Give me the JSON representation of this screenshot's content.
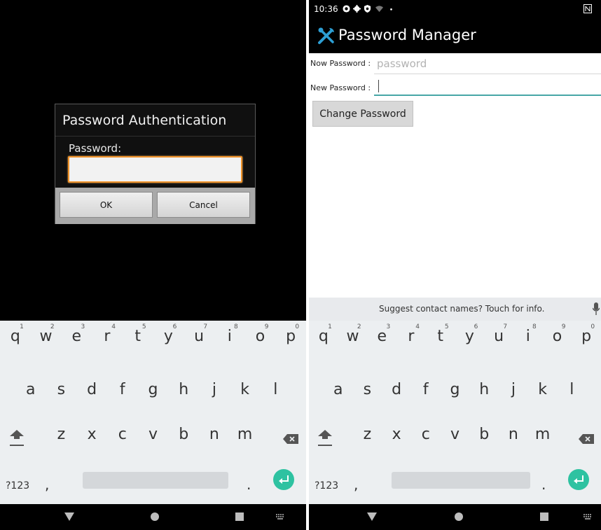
{
  "dialog": {
    "title": "Password Authentication",
    "password_label": "Password:",
    "ok_label": "OK",
    "cancel_label": "Cancel"
  },
  "status": {
    "time": "10:36"
  },
  "app": {
    "title": "Password Manager",
    "now_password_label": "Now Password :",
    "now_password_placeholder": "password",
    "new_password_label": "New Password :",
    "change_button": "Change Password"
  },
  "suggestion": {
    "text": "Suggest contact names? Touch for info."
  },
  "keyboard": {
    "row1": [
      {
        "k": "q",
        "h": "1"
      },
      {
        "k": "w",
        "h": "2"
      },
      {
        "k": "e",
        "h": "3"
      },
      {
        "k": "r",
        "h": "4"
      },
      {
        "k": "t",
        "h": "5"
      },
      {
        "k": "y",
        "h": "6"
      },
      {
        "k": "u",
        "h": "7"
      },
      {
        "k": "i",
        "h": "8"
      },
      {
        "k": "o",
        "h": "9"
      },
      {
        "k": "p",
        "h": "0"
      }
    ],
    "row2": [
      "a",
      "s",
      "d",
      "f",
      "g",
      "h",
      "j",
      "k",
      "l"
    ],
    "row3": [
      "z",
      "x",
      "c",
      "v",
      "b",
      "n",
      "m"
    ],
    "symbols_label": "?123",
    "comma": ",",
    "period": "."
  },
  "colors": {
    "accent": "#47a6a6",
    "focus_orange": "#f0932b",
    "enter_key": "#2ec2a1"
  }
}
